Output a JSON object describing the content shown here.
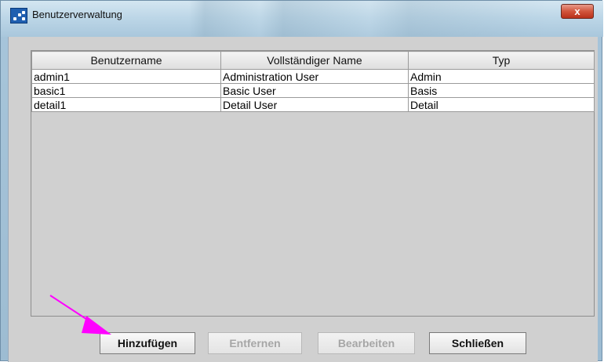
{
  "window": {
    "title": "Benutzerverwaltung",
    "close_label": "x"
  },
  "table": {
    "columns": [
      "Benutzername",
      "Vollständiger Name",
      "Typ"
    ],
    "rows": [
      [
        "admin1",
        "Administration User",
        "Admin"
      ],
      [
        "basic1",
        "Basic User",
        "Basis"
      ],
      [
        "detail1",
        "Detail User",
        "Detail"
      ]
    ]
  },
  "buttons": {
    "add": "Hinzufügen",
    "remove": "Entfernen",
    "edit": "Bearbeiten",
    "close": "Schließen"
  },
  "annotation": {
    "arrow_color": "#ff00ff"
  }
}
